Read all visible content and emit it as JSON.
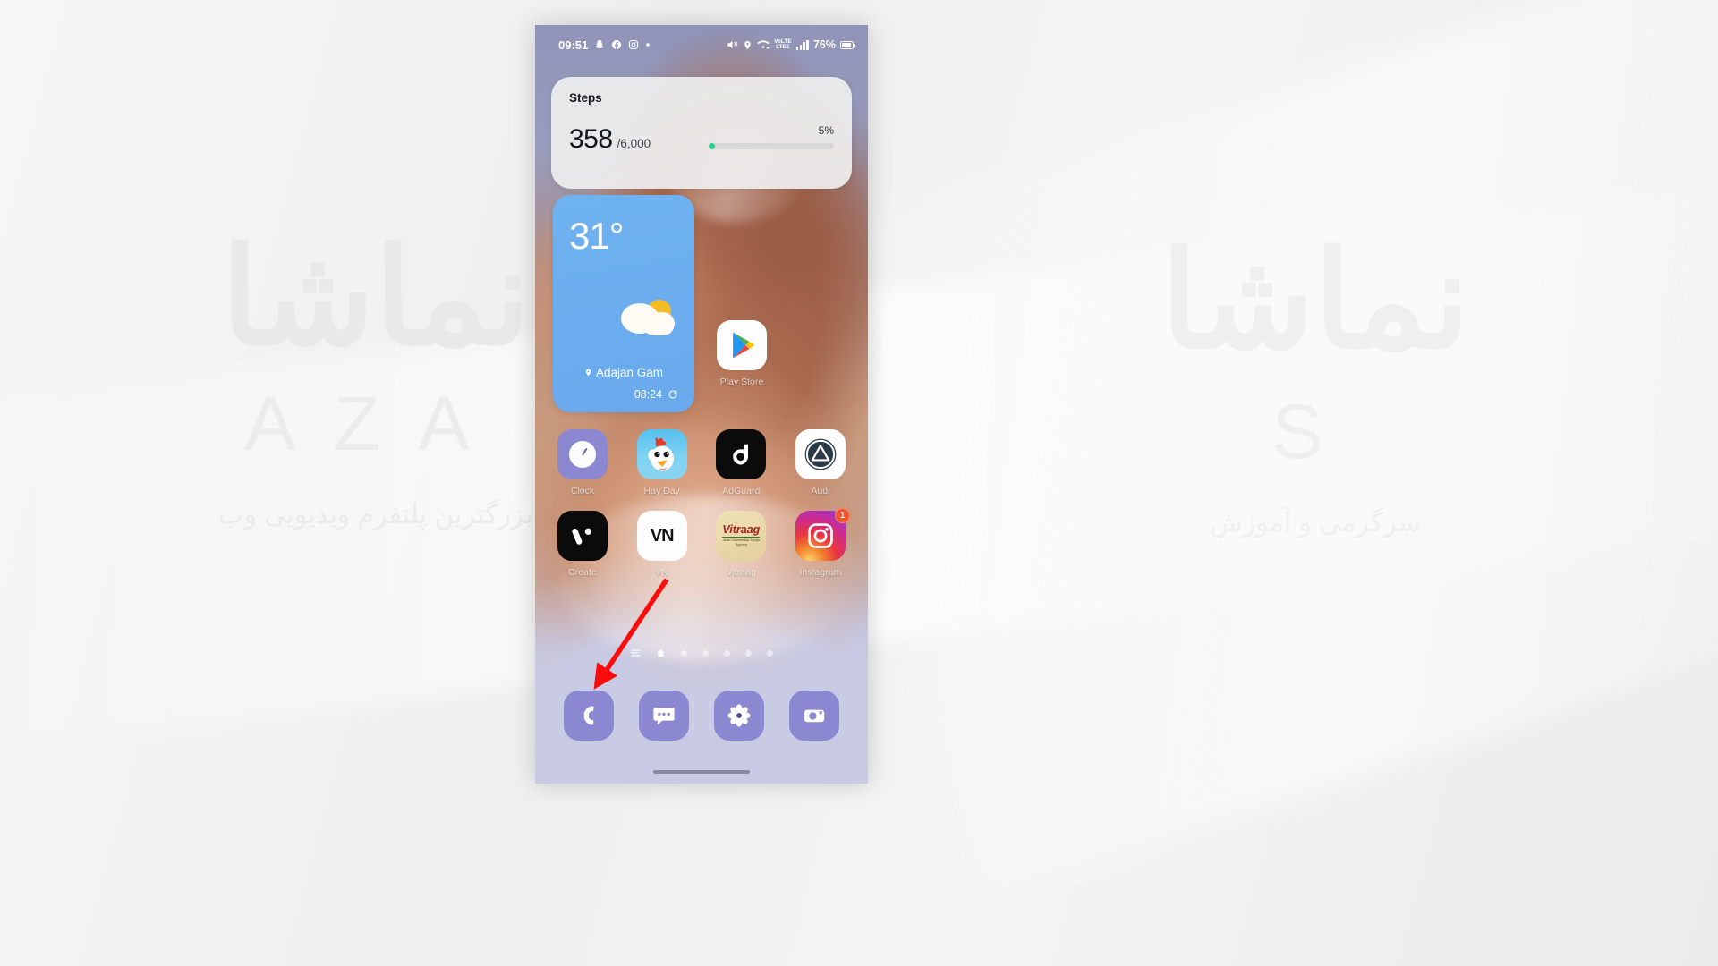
{
  "watermark": {
    "left_main": "نماشا",
    "left_sub": "AZA",
    "left_fa": "بزرگترین پلتفرم ویدیویی وب",
    "right_main": "نماشا",
    "right_sub": "S",
    "right_fa": "سرگرمی و آموزش"
  },
  "statusbar": {
    "time": "09:51",
    "left_icons": [
      "snapchat-icon",
      "facebook-icon",
      "instagram-icon",
      "dot-icon"
    ],
    "mute_icon": "mute-icon",
    "location_icon": "location-icon",
    "wifi_icon": "wifi-icon",
    "volte_line1": "VoLTE",
    "volte_line2": "LTE1",
    "signal_icon": "signal-bars-icon",
    "battery_text": "76%",
    "battery_icon": "battery-icon"
  },
  "steps_widget": {
    "title": "Steps",
    "count": "358",
    "goal": "/6,000",
    "percent_label": "5%",
    "percent_value": 5,
    "progress_color": "#2ecb8e"
  },
  "weather_widget": {
    "temperature": "31°",
    "condition_icon": "partly-cloudy-icon",
    "location_icon": "location-pin-icon",
    "location": "Adajan Gam",
    "updated_time": "08:24",
    "refresh_icon": "refresh-icon",
    "background_color": "#6badee"
  },
  "playstore": {
    "label": "Play Store",
    "icon": "play-store-icon"
  },
  "app_grid": {
    "rows": [
      [
        {
          "name": "clock-app",
          "label": "Clock",
          "icon": "clock-icon",
          "bg": "#8b87d0"
        },
        {
          "name": "hay-day-app",
          "label": "Hay Day",
          "icon": "chicken-icon",
          "bg": "#5ec3ef"
        },
        {
          "name": "adguard-app",
          "label": "AdGuard",
          "icon": "adguard-icon",
          "bg": "#0b0b0b"
        },
        {
          "name": "audi-app",
          "label": "Audi",
          "icon": "triangle-circle-icon",
          "bg": "#ffffff"
        }
      ],
      [
        {
          "name": "vimeo-app",
          "label": "Create",
          "icon": "v-mark-icon",
          "bg": "#0b0b0b"
        },
        {
          "name": "vn-app",
          "label": "VN",
          "icon": "vn-text-icon",
          "bg": "#ffffff",
          "icon_text": "VN"
        },
        {
          "name": "vitraag-app",
          "label": "Vitraag",
          "icon": "vitraag-icon",
          "bg": "#e8d7a6",
          "icon_text": "Vitraag",
          "icon_sub1": "Jinan Shanthimkar Sangh",
          "icon_sub2": "Sydney"
        },
        {
          "name": "instagram-app",
          "label": "Instagram",
          "icon": "instagram-icon",
          "bg": "#e1306c",
          "badge": "1"
        }
      ]
    ]
  },
  "page_indicator": {
    "lines_icon": "app-list-icon",
    "home_icon": "home-icon",
    "dots": 5,
    "active_index": 1
  },
  "dock": {
    "items": [
      {
        "name": "phone-app",
        "icon": "phone-icon"
      },
      {
        "name": "messages-app",
        "icon": "message-bubble-icon"
      },
      {
        "name": "gallery-app",
        "icon": "flower-icon"
      },
      {
        "name": "camera-app",
        "icon": "camera-icon"
      }
    ]
  },
  "annotation": {
    "arrow_color": "#fb0d0d",
    "arrow_name": "red-pointer-arrow"
  },
  "navbar": {
    "pill": "gesture-pill"
  }
}
